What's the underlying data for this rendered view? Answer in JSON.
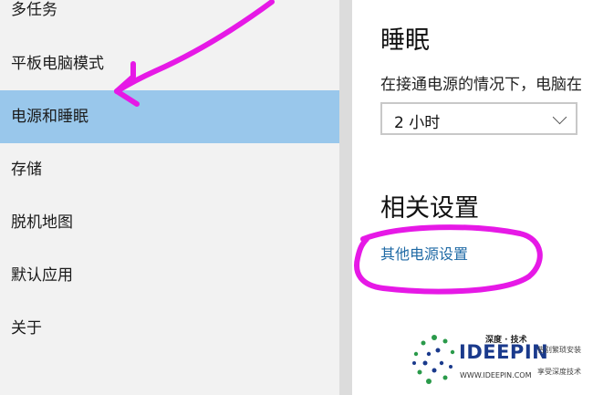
{
  "sidebar": {
    "items": [
      {
        "label": "多任务",
        "selected": false
      },
      {
        "label": "平板电脑模式",
        "selected": false
      },
      {
        "label": "电源和睡眠",
        "selected": true
      },
      {
        "label": "存储",
        "selected": false
      },
      {
        "label": "脱机地图",
        "selected": false
      },
      {
        "label": "默认应用",
        "selected": false
      },
      {
        "label": "关于",
        "selected": false
      }
    ]
  },
  "main": {
    "sleep_heading": "睡眠",
    "sleep_description": "在接通电源的情况下，电脑在",
    "sleep_select_value": "2 小时",
    "related_heading": "相关设置",
    "power_settings_link": "其他电源设置"
  },
  "watermark": {
    "brand_top": "深度 · 技术",
    "brand": "IDEEPIN",
    "url": "WWW.IDEEPIN.COM",
    "slogan1": "告别繁琐安装",
    "slogan2": "享受深度技术"
  },
  "colors": {
    "selected_bg": "#99c7eb",
    "sidebar_bg": "#f2f2f2",
    "link": "#1f6aa5",
    "annotation": "#e619e6"
  },
  "icons": [
    "dropdown-chevron-icon",
    "ideepin-logo-icon"
  ]
}
